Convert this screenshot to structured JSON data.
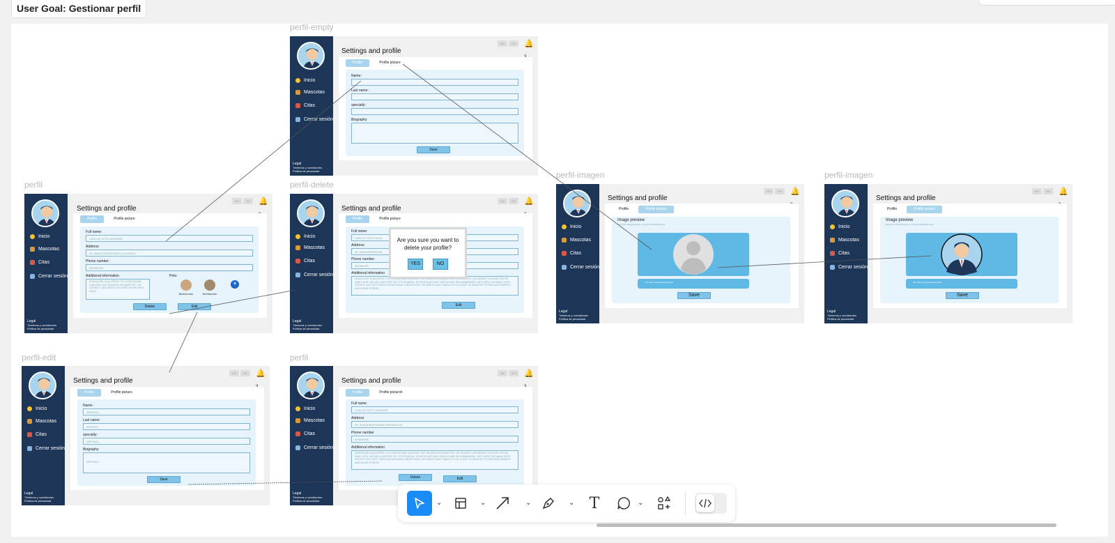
{
  "goal_label": "User Goal: Gestionar perfil",
  "frame_labels": {
    "perfil_empty": "perfil-empty",
    "perfil": "perfil",
    "perfil_delete": "perfil-delete",
    "perfil_imagen_1": "perfil-imagen",
    "perfil_imagen_2": "perfil-imagen",
    "perfil_edit": "perfil-edit",
    "perfil_bottom": "perfil"
  },
  "common": {
    "title": "Settings and profile",
    "tab_profile": "Profile",
    "tab_picture": "Profile picture",
    "tab_picture_alt": "Profile picturoh",
    "nav_inicio": "Inicio",
    "nav_mascotas": "Mascotas",
    "nav_citas": "Citas",
    "nav_cerrar": "Cerrar sesión",
    "legal_title": "Legal",
    "legal_terms": "Términos y condiciones",
    "legal_privacy": "Política de privacidad",
    "bell_count": "3",
    "lang_1": "EN",
    "lang_2": "ES"
  },
  "empty_form": {
    "name_label": "Name:",
    "lastname_label": "Last name:",
    "specialty_label": "specialty:",
    "biography_label": "Biography",
    "save": "Save"
  },
  "edit_form": {
    "name_label": "Name:",
    "lastname_label": "Last name:",
    "specialty_label": "specialty:",
    "biography_label": "Biography",
    "placeholder": "WRITING...",
    "save": "Save"
  },
  "profile": {
    "fullname_label": "Full name:",
    "fullname": "CARLOS SOTO AGUIRRE",
    "address_label": "Address:",
    "address": "AV. MANGOPAPAYA#321-LALANDIA",
    "phone_label": "Phone number:",
    "phone": "987654321",
    "additional_label": "Additional information",
    "additional": "SHAGGUSH IS ALLERGIC TO CHICKEN AND CAN ONLY EAT SALMON CROQUETTES. HE DOESN'T LIKE BEING TOUCHED ON HIS HIND LEGS.",
    "pets_label": "Pets:",
    "pet1": "Bartolombu",
    "pet2": "Bombardiro",
    "delete": "Delete",
    "edit": "Edit"
  },
  "delete_frame": {
    "fullname_label": "Full name:",
    "fullname": "CARLOS SOTO AGUI",
    "address_label": "Address:",
    "address": "AV. MANGOPAPAYA#",
    "phone_label": "Phone number:",
    "phone": "987654321",
    "additional_label": "Additional information",
    "additional": "SHAGGUSH IS ALLERGIC TO CHICKEN AND CAN ONLY EAT SALMON CROQUETTES. HE DOESN'T LIKE BEING TOUCHED ON HIS HIND LEGS. HE HAS A HISTORY OF OTITIS MEDIA, SO REGULAR EAR CHECKS ARE RECOMMENDED. HE'S VERY SOCIABLE WITH PEOPLE, BUT GETS NERVOUS AROUND LARGE DOGS. HE NEEDS DAILY WALKS OF AT LEAST 30 MINUTES TO RELEASE ENERGY AND AVOID STRESS.",
    "edit": "Edit",
    "dialog_text_1": "Are you sure you want to",
    "dialog_text_2": "delete your profile?",
    "yes": "YES",
    "no": "NO"
  },
  "image_frame": {
    "preview_label": "Image preview",
    "preview_hint": "Minimum 200x200 pixels, maximum 800x800 pixels",
    "file_text": "You have not selected any files",
    "save": "Save"
  },
  "bottom_profile": {
    "fullname_label": "Full name",
    "fullname": "CARLOS SOTO AGUIRRE",
    "address_label": "Address",
    "address": "AV. ROSAPAKETE#385-PEPINILIEVA",
    "phone_label": "Phone number",
    "phone": "999999999",
    "additional_label": "Additional information",
    "additional": "SHAGGUSH IS ALLERGIC TO CHICKEN AND CAN ONLY EAT SALMON CROQUETTES. HE DOESN'T LIKE BEING TOUCHED ON HIS HIND LEGS. HE HAS A HISTORY OF OTITIS MEDIA, SO REGULAR EAR CHECKS ARE RECOMMENDED. HE'S VERY SOCIABLE WITH PEOPLE, BUT GETS NERVOUS AROUND LARGE DOGS. HE NEEDS DAILY WALKS OF AT LEAST 30 MINUTES TO RELEASE ENERGY AND AVOID STRESS.",
    "delete": "Delete",
    "edit": "Edit"
  },
  "toolbar": {
    "tools": [
      "pointer-icon",
      "frame-icon",
      "arrow-icon",
      "pen-icon",
      "text-icon",
      "comment-icon",
      "components-icon",
      "code-icon"
    ],
    "text_tool_glyph": "T",
    "caret": "⌄",
    "active_color": "#1a8cf7"
  }
}
